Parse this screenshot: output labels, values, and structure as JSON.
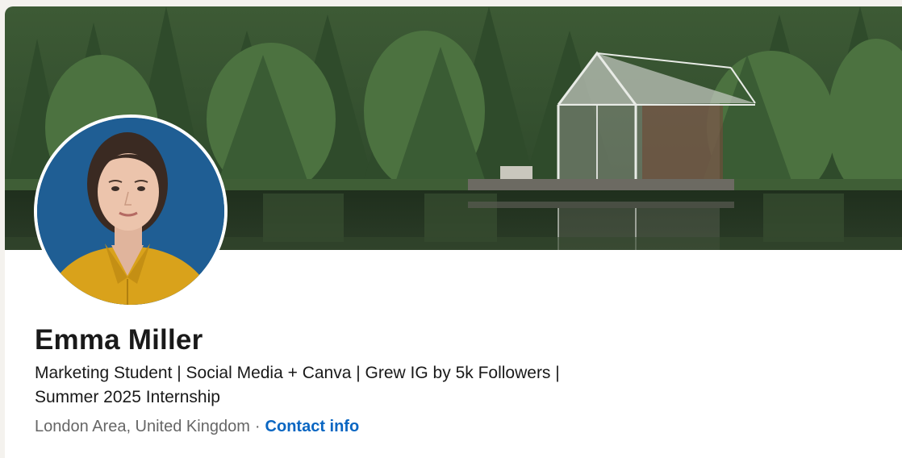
{
  "profile": {
    "name": "Emma Miller",
    "headline_line1": "Marketing Student | Social Media + Canva | Grew IG by 5k Followers |",
    "headline_line2": "Summer 2025 Internship",
    "location": "London Area, United Kingdom",
    "separator": "·",
    "contact_label": "Contact info"
  },
  "colors": {
    "link": "#0a66c2",
    "text_primary": "#191919",
    "text_secondary": "#666666",
    "avatar_background": "#1f5e94",
    "avatar_shirt": "#d9a21b"
  },
  "images": {
    "banner": "forest-lake-glass-cabin",
    "avatar": "profile-photo-woman-yellow-shirt"
  }
}
